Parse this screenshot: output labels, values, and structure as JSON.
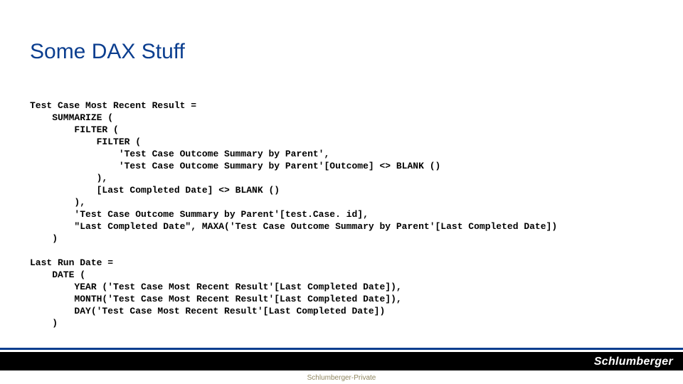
{
  "title": "Some DAX Stuff",
  "code": "Test Case Most Recent Result =\n    SUMMARIZE (\n        FILTER (\n            FILTER (\n                'Test Case Outcome Summary by Parent',\n                'Test Case Outcome Summary by Parent'[Outcome] <> BLANK ()\n            ),\n            [Last Completed Date] <> BLANK ()\n        ),\n        'Test Case Outcome Summary by Parent'[test.Case. id],\n        \"Last Completed Date\", MAXA('Test Case Outcome Summary by Parent'[Last Completed Date])\n    )\n\nLast Run Date =\n    DATE (\n        YEAR ('Test Case Most Recent Result'[Last Completed Date]),\n        MONTH('Test Case Most Recent Result'[Last Completed Date]),\n        DAY('Test Case Most Recent Result'[Last Completed Date])\n    )",
  "brand": "Schlumberger",
  "confidentiality": "Schlumberger-Private"
}
